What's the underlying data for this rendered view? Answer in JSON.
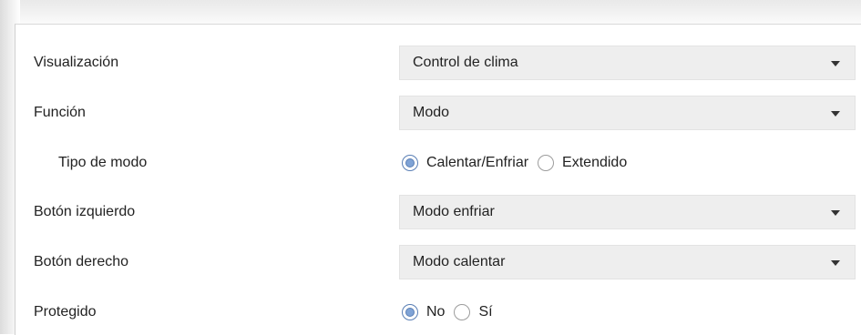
{
  "rows": [
    {
      "label": "Visualización",
      "type": "select",
      "value": "Control de clima"
    },
    {
      "label": "Función",
      "type": "select",
      "value": "Modo"
    },
    {
      "label": "Tipo de modo",
      "type": "radio",
      "options": [
        "Calentar/Enfriar",
        "Extendido"
      ],
      "selected": "Calentar/Enfriar"
    },
    {
      "label": "Botón izquierdo",
      "type": "select",
      "value": "Modo enfriar"
    },
    {
      "label": "Botón derecho",
      "type": "select",
      "value": "Modo calentar"
    },
    {
      "label": "Protegido",
      "type": "radio",
      "options": [
        "No",
        "Sí"
      ],
      "selected": "No"
    }
  ],
  "colors": {
    "select_bg": "#eeeeee",
    "radio_checked": "#7fa3d6",
    "radio_border_checked": "#5a7fb5"
  },
  "icons": {
    "dropdown": "chevron-down-icon"
  }
}
